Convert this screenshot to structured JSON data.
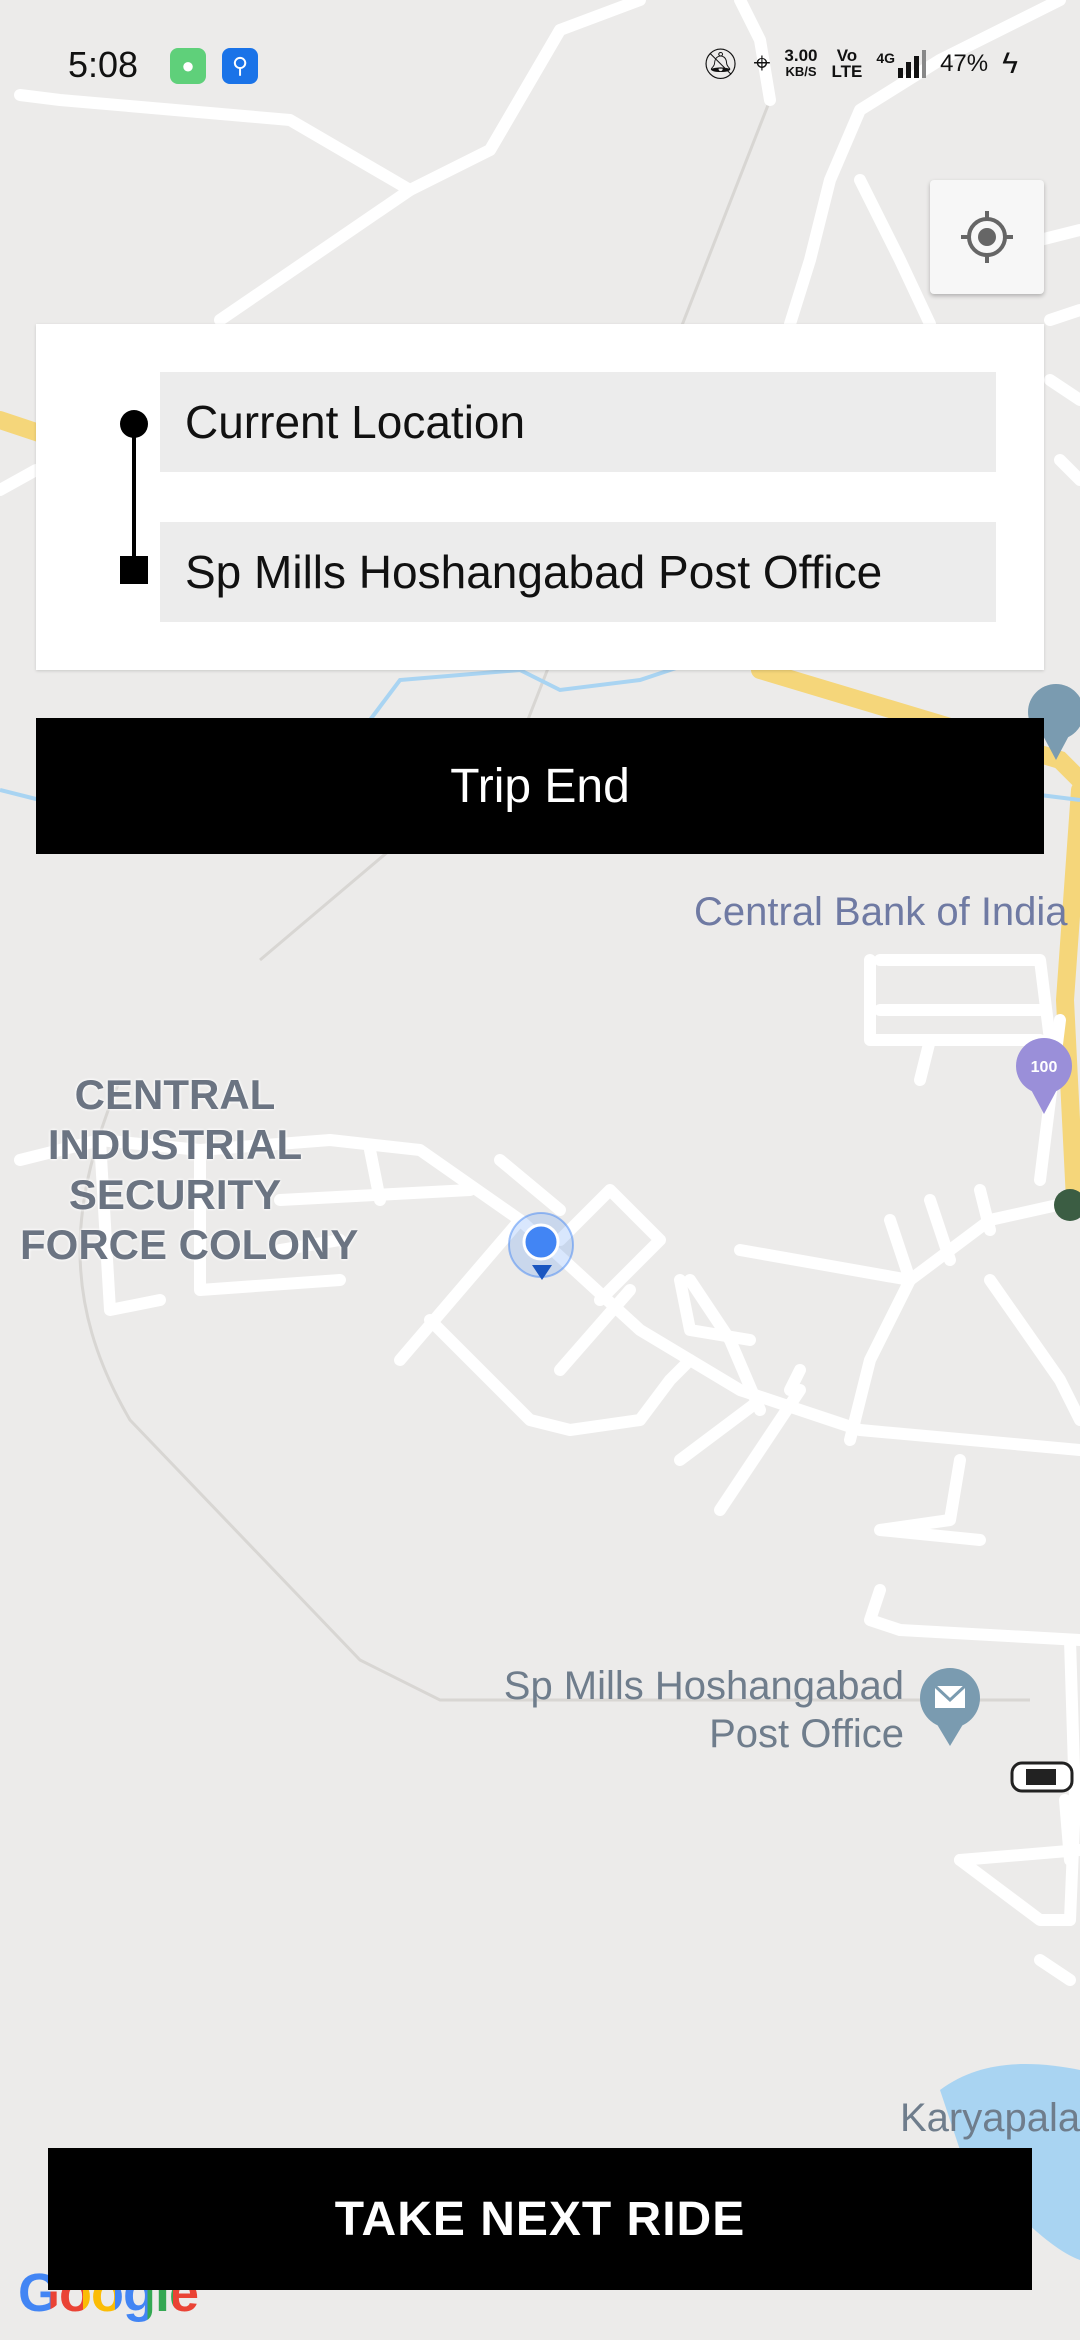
{
  "status_bar": {
    "time": "5:08",
    "net_speed_value": "3.00",
    "net_speed_unit": "KB/S",
    "volte_top": "Vo",
    "volte_bottom": "LTE",
    "network_type": "4G",
    "battery": "47%",
    "icons": [
      "whatsapp-like-app-icon",
      "usb-icon",
      "notifications-off-icon",
      "location-icon",
      "signal-icon",
      "charging-icon"
    ]
  },
  "route": {
    "pickup": "Current Location",
    "destination": "Sp Mills Hoshangabad Post Office"
  },
  "buttons": {
    "trip_end": "Trip End",
    "take_next_ride": "TAKE NEXT RIDE"
  },
  "map": {
    "poi_central_bank": "Central Bank of India",
    "area_line1": "CENTRAL",
    "area_line2": "INDUSTRIAL",
    "area_line3": "SECURITY",
    "area_line4": "FORCE COLONY",
    "post_office_line1": "Sp Mills Hoshangabad",
    "post_office_line2": "Post Office",
    "karyapala": "Karyapala",
    "google": "Google",
    "colors": {
      "background": "#ecebea",
      "road": "#ffffff",
      "highway": "#f5d67a",
      "water": "#a9d4f2",
      "user_location": "#4285f4",
      "poi_pin": "#7a9bb0"
    }
  }
}
